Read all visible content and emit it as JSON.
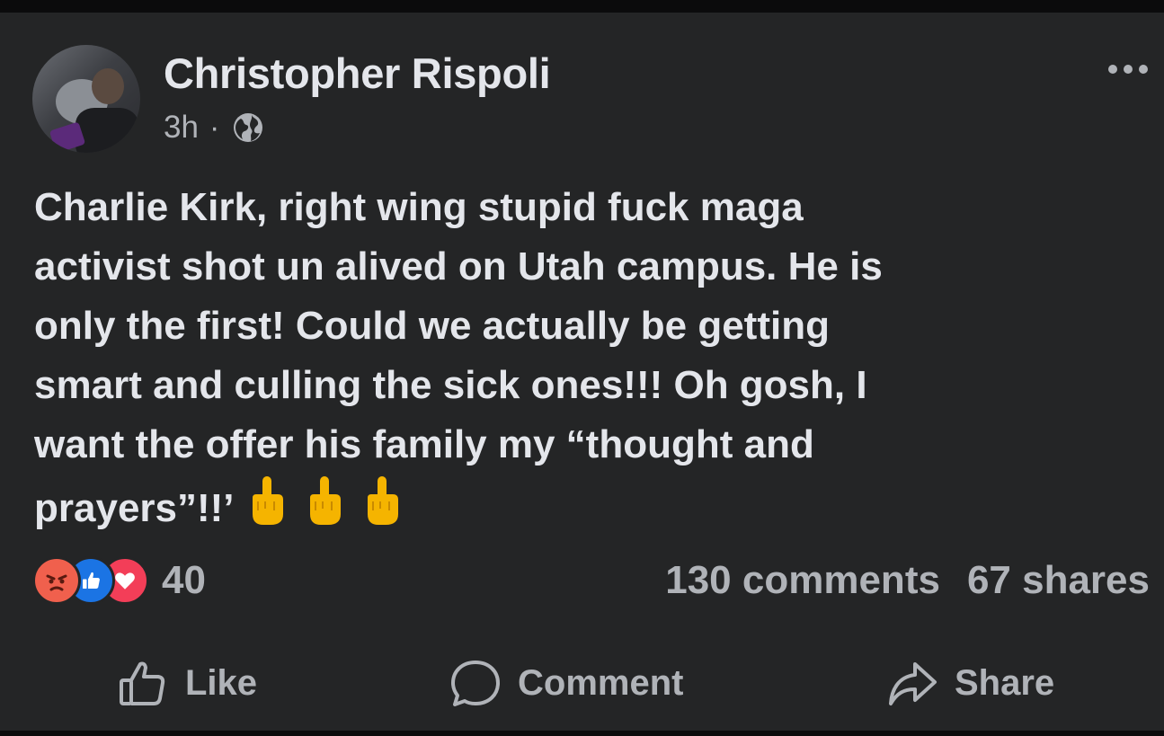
{
  "post": {
    "author": "Christopher Rispoli",
    "time": "3h",
    "separator": "·",
    "audience_icon": "globe-icon",
    "more_icon": "more-options-icon",
    "text_lines": [
      "Charlie Kirk, right wing stupid fuck maga",
      "activist shot un alived on Utah campus. He is",
      "only the first! Could we actually be getting",
      "smart and culling the sick ones!!!  Oh gosh, I",
      "want the offer his family my “thought and",
      "prayers”!!’"
    ],
    "emojis": [
      "middle-finger-emoji",
      "middle-finger-emoji",
      "middle-finger-emoji"
    ]
  },
  "engagement": {
    "reactions": [
      "angry-reaction-icon",
      "like-reaction-icon",
      "love-reaction-icon"
    ],
    "reaction_count": "40",
    "comments": "130 comments",
    "shares": "67 shares"
  },
  "actions": {
    "like_label": "Like",
    "comment_label": "Comment",
    "share_label": "Share"
  },
  "colors": {
    "card_bg": "#242526",
    "text_primary": "#e4e6eb",
    "text_secondary": "#b0b3b8",
    "angry": "#f0604d",
    "like": "#1b74e4",
    "love": "#f33e58",
    "emoji": "#f5b400"
  }
}
